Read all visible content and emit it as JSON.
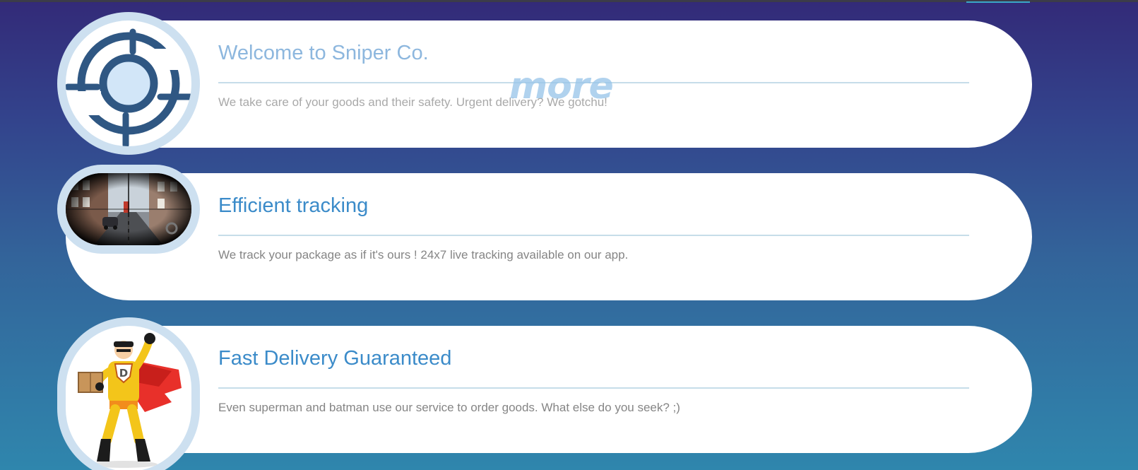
{
  "overlay_text": "more",
  "features": [
    {
      "title": "Welcome to Sniper Co.",
      "description": "We take care of your goods and their safety. Urgent delivery? We gotchu!",
      "icon": "crosshair-icon"
    },
    {
      "title": "Efficient tracking",
      "description": "We track your package as if it's ours ! 24x7 live tracking available on our app.",
      "icon": "scope-view-image"
    },
    {
      "title": "Fast Delivery Guaranteed",
      "description": "Even superman and batman use our service to order goods. What else do you seek? ;)",
      "icon": "superhero-courier-image",
      "badge_letter": "D"
    }
  ],
  "colors": {
    "title": "#3b8bc9",
    "description": "#858585",
    "ring": "#cde0f0",
    "crosshair": "#2f5783",
    "crosshair_fill": "#d2e6f8"
  }
}
